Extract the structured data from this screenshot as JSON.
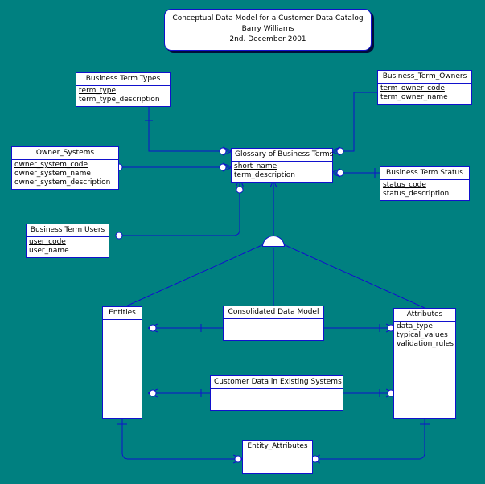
{
  "diagram": {
    "background_color": "#008080",
    "line_color": "#1111cc",
    "box_fill": "#ffffff",
    "notation": "crow's foot"
  },
  "title_note": {
    "line1": "Conceptual Data Model for a Customer Data Catalog",
    "line2": "Barry Williams",
    "line3": "2nd. December 2001"
  },
  "entities": [
    {
      "id": "business_term_types",
      "name": "Business Term Types",
      "attributes": [
        {
          "label": "term_type",
          "key": true
        },
        {
          "label": "term_type_description",
          "key": false
        }
      ]
    },
    {
      "id": "business_term_owners",
      "name": "Business_Term_Owners",
      "attributes": [
        {
          "label": "term_owner_code",
          "key": true
        },
        {
          "label": "term_owner_name",
          "key": false
        }
      ]
    },
    {
      "id": "owner_systems",
      "name": "Owner_Systems",
      "attributes": [
        {
          "label": "owner_system_code",
          "key": true
        },
        {
          "label": "owner_system_name",
          "key": false
        },
        {
          "label": "owner_system_description",
          "key": false
        }
      ]
    },
    {
      "id": "glossary_of_business_terms",
      "name": "Glossary of Business Terms",
      "attributes": [
        {
          "label": "short_name",
          "key": true
        },
        {
          "label": "term_description",
          "key": false
        }
      ]
    },
    {
      "id": "business_term_status",
      "name": "Business Term Status",
      "attributes": [
        {
          "label": "status_code",
          "key": true
        },
        {
          "label": "status_description",
          "key": false
        }
      ]
    },
    {
      "id": "business_term_users",
      "name": "Business Term Users",
      "attributes": [
        {
          "label": "user_code",
          "key": true
        },
        {
          "label": "user_name",
          "key": false
        }
      ]
    },
    {
      "id": "entities",
      "name": "Entities",
      "attributes": []
    },
    {
      "id": "consolidated_data_model",
      "name": "Consolidated Data Model",
      "attributes": []
    },
    {
      "id": "attributes",
      "name": "Attributes",
      "attributes": [
        {
          "label": "data_type",
          "key": false
        },
        {
          "label": "typical_values",
          "key": false
        },
        {
          "label": "validation_rules",
          "key": false
        }
      ]
    },
    {
      "id": "customer_data_in_existing_systems",
      "name": "Customer Data in Existing Systems",
      "attributes": []
    },
    {
      "id": "entity_attributes",
      "name": "Entity_Attributes",
      "attributes": []
    }
  ]
}
